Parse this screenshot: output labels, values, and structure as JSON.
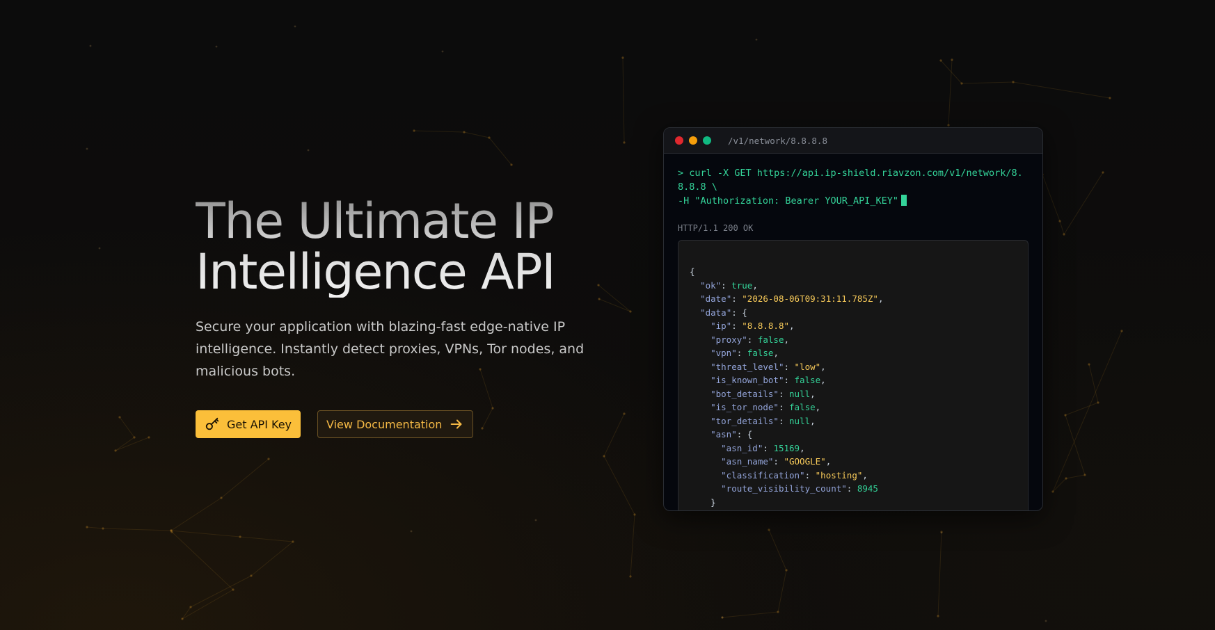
{
  "hero": {
    "title_line1": "The Ultimate IP",
    "title_line2": "Intelligence API",
    "subtitle": "Secure your application with blazing-fast edge-native IP intelligence. Instantly detect proxies, VPNs, Tor nodes, and malicious bots.",
    "primary_button": {
      "label": "Get API Key",
      "icon": "key-icon"
    },
    "secondary_button": {
      "label": "View Documentation",
      "icon": "arrow-right-icon"
    }
  },
  "terminal": {
    "path": "/v1/network/8.8.8.8",
    "command": "> curl -X GET https://api.ip-shield.riavzon.com/v1/network/8.8.8.8 \\\n-H \"Authorization: Bearer YOUR_API_KEY\"",
    "status": "HTTP/1.1 200 OK",
    "response": {
      "ok": true,
      "date": "2026-08-06T09:31:11.785Z",
      "data": {
        "ip": "8.8.8.8",
        "proxy": false,
        "vpn": false,
        "threat_level": "low",
        "is_known_bot": false,
        "bot_details": null,
        "is_tor_node": false,
        "tor_details": null,
        "asn": {
          "asn_id": 15169,
          "asn_name": "GOOGLE",
          "classification": "hosting",
          "route_visibility_count": 8945
        }
      }
    }
  },
  "colors": {
    "accent": "#fbbf3a",
    "accent_text": "#f5b945",
    "terminal_green": "#34d399",
    "json_key": "#93a4d9",
    "json_string": "#facc5a"
  }
}
